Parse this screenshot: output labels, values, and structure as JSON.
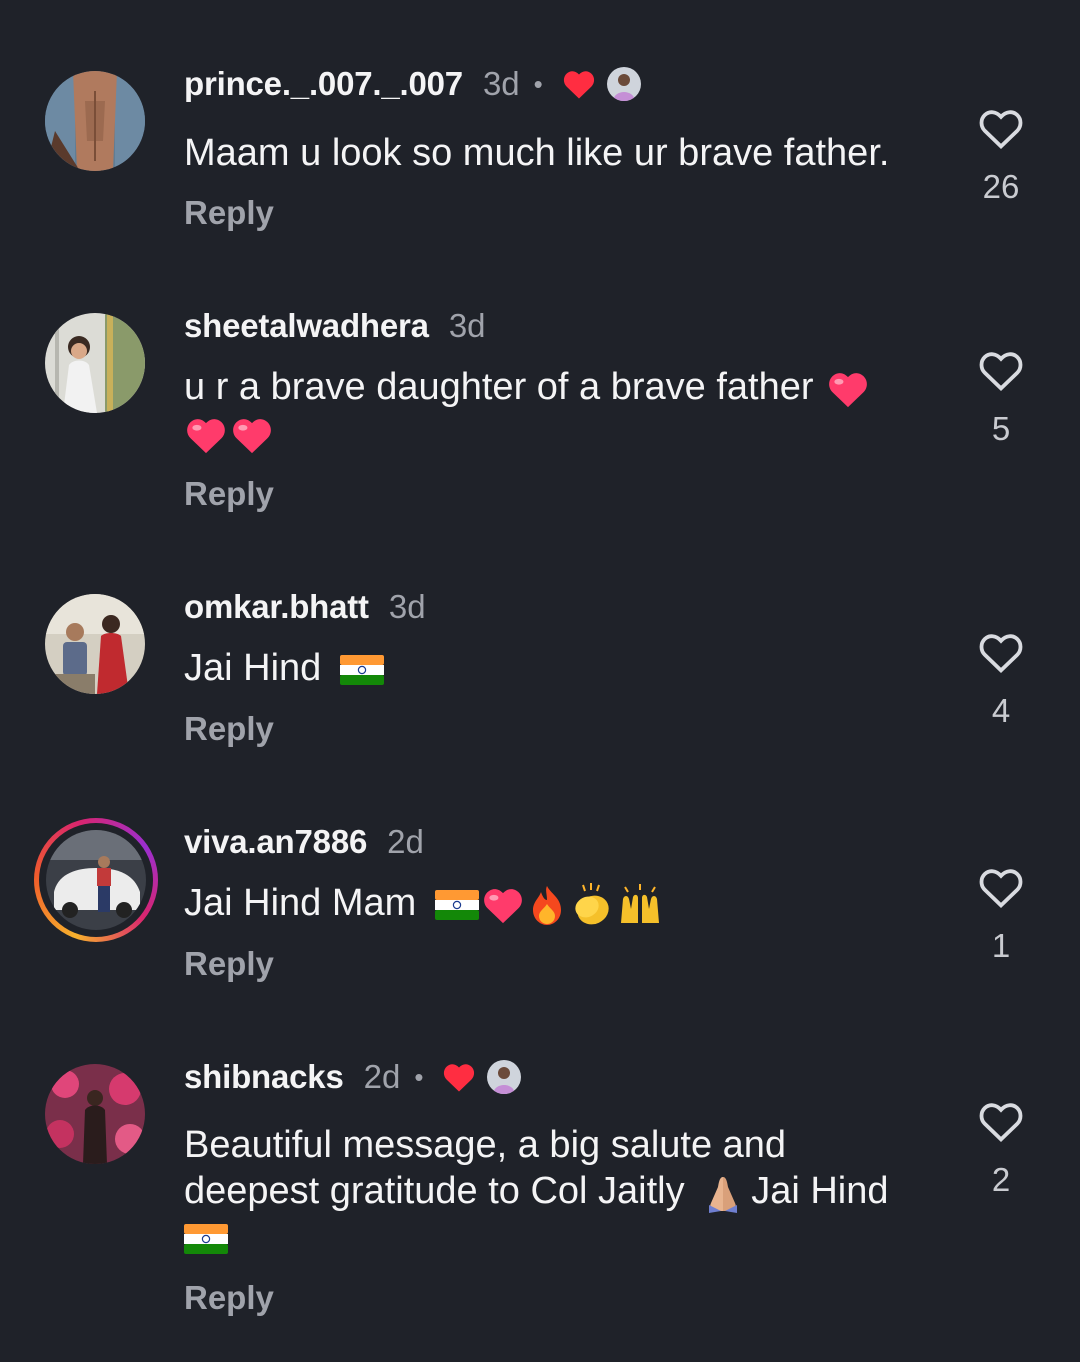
{
  "comments": [
    {
      "username": "prince._.007._.007",
      "time": "3d",
      "separator": "•",
      "liked_by_author": true,
      "text": "Maam u look so much like ur brave father.",
      "reply_label": "Reply",
      "likes": "26"
    },
    {
      "username": "sheetalwadhera",
      "time": "3d",
      "liked_by_author": false,
      "text": "u r a brave daughter of a brave father",
      "emojis": [
        "heart",
        "heart",
        "heart"
      ],
      "reply_label": "Reply",
      "likes": "5"
    },
    {
      "username": "omkar.bhatt",
      "time": "3d",
      "liked_by_author": false,
      "text": "Jai Hind",
      "emojis": [
        "india-flag"
      ],
      "reply_label": "Reply",
      "likes": "4"
    },
    {
      "username": "viva.an7886",
      "time": "2d",
      "liked_by_author": false,
      "has_story_ring": true,
      "text": "Jai Hind Mam",
      "emojis": [
        "india-flag",
        "heart",
        "fire",
        "clapping-hands",
        "raising-hands"
      ],
      "reply_label": "Reply",
      "likes": "1"
    },
    {
      "username": "shibnacks",
      "time": "2d",
      "separator": "•",
      "liked_by_author": true,
      "text_line1": "Beautiful message, a big salute and",
      "text_line2": "deepest gratitude to Col Jaitly",
      "text_line2_after": "Jai Hind",
      "emojis": [
        "folded-hands",
        "india-flag"
      ],
      "reply_label": "Reply",
      "likes": "2"
    }
  ],
  "colors": {
    "background": "#1f2229",
    "text": "#f4f4f5",
    "muted": "#a0a3ab",
    "heart_red": "#ff2d41"
  }
}
